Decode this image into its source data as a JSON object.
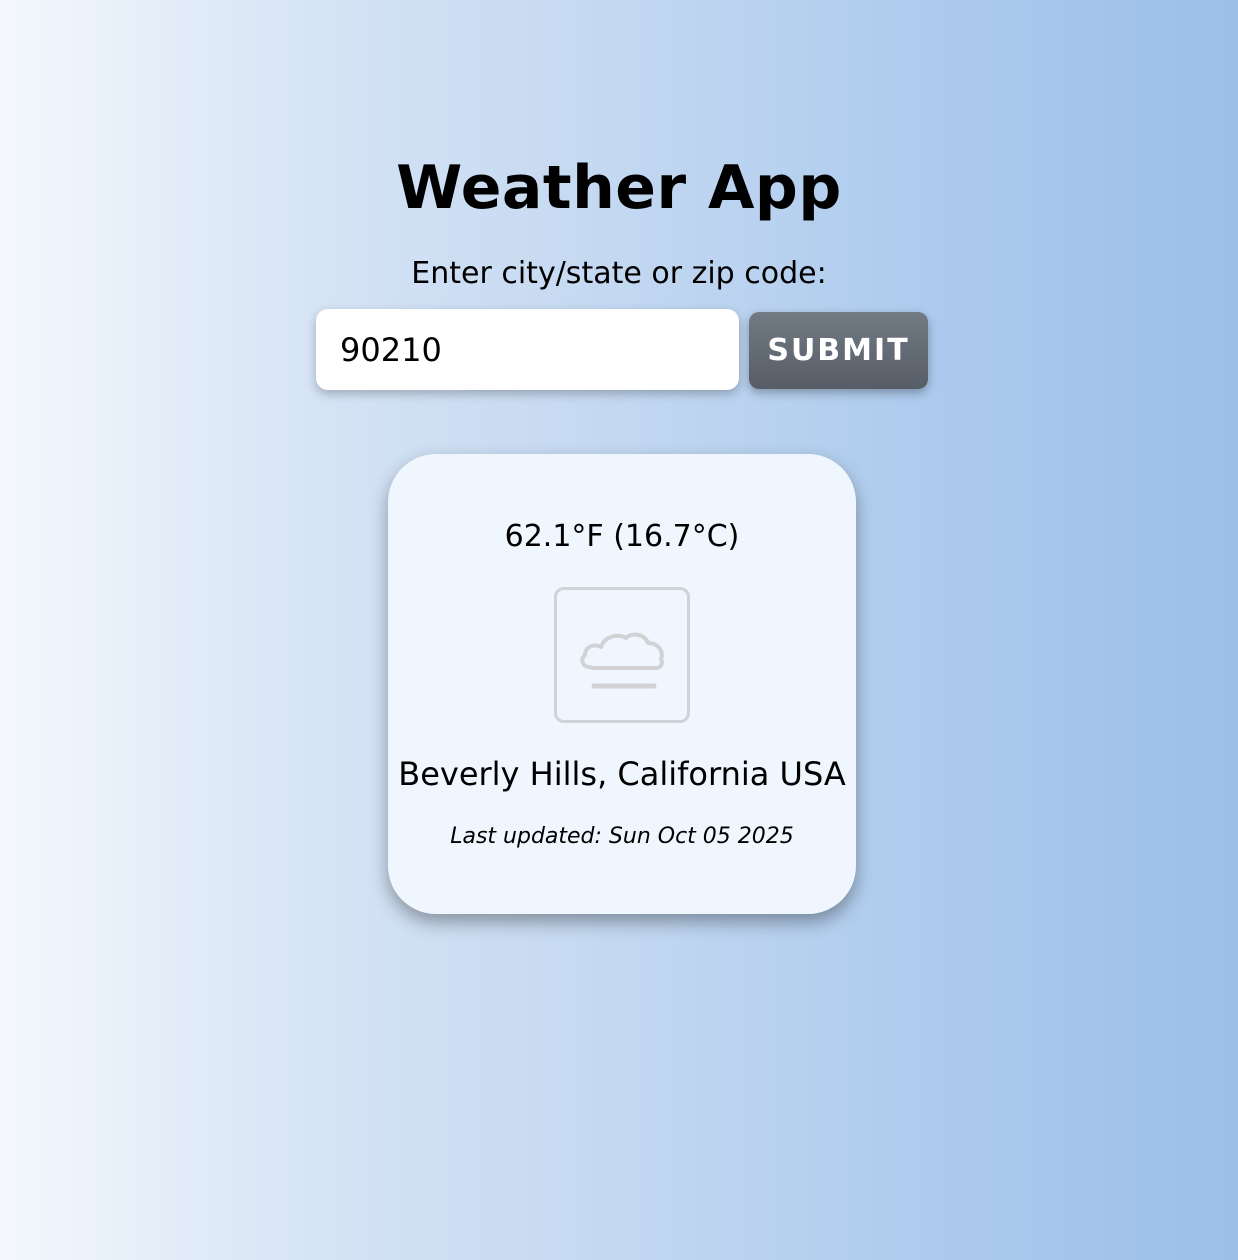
{
  "app": {
    "title": "Weather App"
  },
  "search": {
    "prompt": "Enter city/state or zip code:",
    "value": "90210",
    "submit_label": "SUBMIT"
  },
  "weather": {
    "temperature": "62.1°F (16.7°C)",
    "icon": "fog-icon",
    "location": "Beverly Hills, California USA",
    "last_updated": "Last updated: Sun Oct 05 2025"
  },
  "colors": {
    "button": "#5f666f",
    "card": "#eff6fd",
    "background_left": "#f4f8fd",
    "background_right": "#9bbfe8"
  }
}
